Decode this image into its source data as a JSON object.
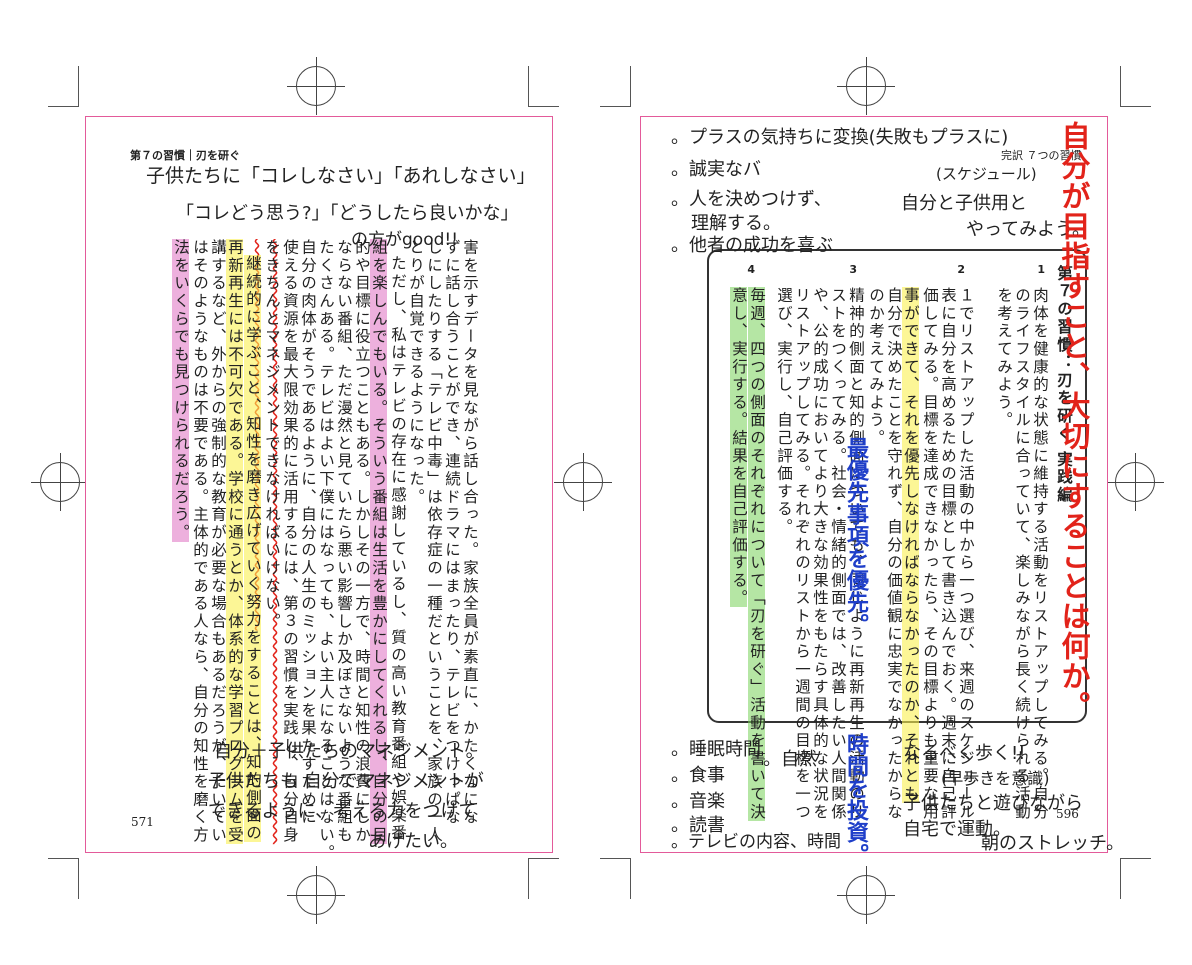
{
  "left_page": {
    "header": "第７の習慣｜刃を研ぐ",
    "page_number": "571",
    "columns": [
      "害を示すデータを見ながら話し合った。家族全員が素直に、かたくなにな",
      "ずに話し合うことができ、連続ドラマにはまったり、テレビをつけっぱな",
      "しにしたりする「テレビ中毒」は依存症の一種だということを、家族の一人",
      "とりが自覚できるようになった。",
      "ただし、私はテレビの存在に感謝しているし、質の高い教育番組や娯楽番",
      "組を楽しんでもいる。そういう番組は生活を豊かにしてくれるし、自分の目",
      "的や目標に役立つこともある。しかしその一方で、時間と知性の浪費にしか",
      "ならない番組、ただ漫然と見ていたら悪い影響しか及ぼさないような番組も",
      "たくさんある。テレビはよい下僕にはなっても、よい主人になることはない。",
      "自分の肉体がそうであるように、自分の人生のミッションを果たすために",
      "使える資源を最大限効果的に活用するには、第３の習慣を実践し、自分自身",
      "をきちんとマネジメントできなければいけない。",
      "継続的に学ぶこと、知性を磨き広げていく努力をすることは、知的側面の",
      "再新再生には不可欠である。学校に通うとか、体系的な学習プログラムを受",
      "講するなど、外からの強制的な教育が必要な場合もあるだろうが、たいてい",
      "はそのようなものは不要である。主体的である人なら、自分の知性を磨く方",
      "法をいくらでも見つけられるだろう。"
    ],
    "handwritten": {
      "top_line1": "子供たちに「コレしなさい」「あれしなさい」",
      "top_line2": "「コレどう思う?」「どうしたら良いかな」",
      "top_line3": "の方がgood!!",
      "bottom_line1": "自分＋子供たちのマネジメント。",
      "bottom_line2": "子供たちも 自分でマネジメントが",
      "bottom_line3": "できるように、考える力をつけて",
      "bottom_line4": "あげたい。"
    }
  },
  "right_page": {
    "header": "完訳 ７つの習慣",
    "page_number": "596",
    "box_title": "第７の習慣：刃を研ぐ 実践編",
    "numbers": [
      "1",
      "2",
      "3",
      "4"
    ],
    "columns": [
      "第７の習慣：刃を研ぐ 実践編",
      "肉体を健康的な状態に維持する活動をリストアップしてみる。自分",
      "のライフスタイルに合っていて、楽しみながら長く続けられる活動",
      "を考えてみよう。",
      "１でリストアップした活動の中から一つ選び、来週のスケジュール",
      "表に自分を高めるための目標として書き込んでおく。週末に自己評",
      "価してみる。目標を達成できなかったら、その目標よりも重要な用",
      "事ができて、それを優先しなければならなかったのか、それとも",
      "自分で決めたことを守れず、自分の価値観に忠実でなかったからな",
      "のか考えてみよう。",
      "精神的側面と知的側面についても、同じように再新再生の活動のリ",
      "ストをつくってみる。社会・情緒的側面では、改善したい人間関係",
      "や、公的成功においてより大きな効果性をもたらす具体的な状況を",
      "リストアップしてみる。それぞれのリストから一週間の目標を一つ",
      "選び、実行し、自己評価する。",
      "毎週、四つの側面のそれぞれについて「刃を研ぐ」活動を書いて決",
      "意し、実行する。結果を自己評価する。"
    ],
    "handwritten": {
      "top_line1": "。プラスの気持ちに変換(失敗もプラスに)",
      "top_line2": "。誠実なバ",
      "top_line3": "。人を決めつけず、",
      "top_line4": "理解する。",
      "top_line5": "。他者の成功を喜ぶ",
      "schedule_note1": "(スケジュール)",
      "schedule_note2": "自分と子供用と",
      "schedule_note3": "やってみよう。",
      "red_vertical": "自分が目指すこと、大切にすることは何か。",
      "blue_priority": "最優先事項を優先。",
      "blue_time": "時間を投資。",
      "list1": "。睡眠時間",
      "list2": "。食事",
      "list3": "。音楽",
      "list4": "。読書",
      "list5": "。テレビの内容、時間",
      "list6": "。自然",
      "walk1": "なるべく歩く!!",
      "walk2": "(早歩きを意識)",
      "walk3": "子供たちと遊びながら",
      "walk4": "自宅で運動。",
      "walk5": "朝のストレッチ。"
    }
  }
}
